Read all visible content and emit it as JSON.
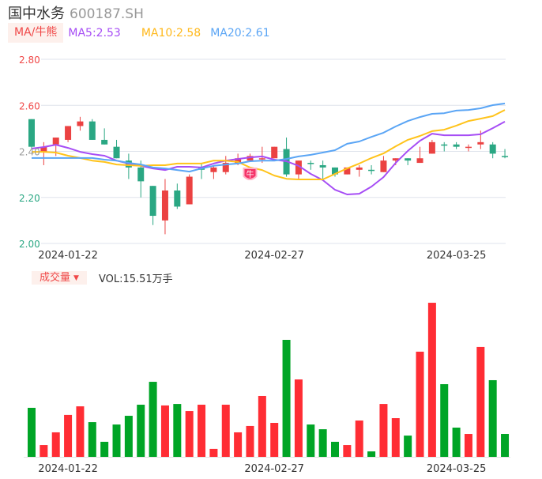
{
  "header": {
    "name": "国中水务",
    "code": "600187.SH"
  },
  "ma_legend": {
    "tag": "MA/牛熊",
    "ma5": "MA5:2.53",
    "ma10": "MA10:2.58",
    "ma20": "MA20:2.61"
  },
  "volume_legend": {
    "tag": "成交量",
    "tag_arrow": "▼",
    "value": "VOL:15.51万手"
  },
  "colors": {
    "up": "#eb4242",
    "down": "#2aa783",
    "vol_up": "#ff2d34",
    "vol_down": "#00a526",
    "ma5": "#a64df5",
    "ma10": "#ffc31a",
    "ma20": "#5aa5f5",
    "grid": "#dfe3ec"
  },
  "marker": {
    "label": "牛",
    "icon": "bull-shield-icon",
    "index": 18
  },
  "chart_data": [
    {
      "type": "candlestick",
      "ylim": [
        2.0,
        2.8
      ],
      "y_ticks": [
        {
          "label": "2.80",
          "value": 2.8,
          "color": "#f04848"
        },
        {
          "label": "2.60",
          "value": 2.6,
          "color": "#f04848"
        },
        {
          "label": "2.40",
          "value": 2.4,
          "color": "#999999"
        },
        {
          "label": "2.20",
          "value": 2.2,
          "color": "#2aa783"
        },
        {
          "label": "2.00",
          "value": 2.0,
          "color": "#2aa783"
        }
      ],
      "x_ticks": [
        {
          "label": "2024-01-22",
          "index": 3
        },
        {
          "label": "2024-02-27",
          "index": 20
        },
        {
          "label": "2024-03-25",
          "index": 35
        }
      ],
      "candles": [
        {
          "o": 2.54,
          "h": 2.54,
          "l": 2.41,
          "c": 2.42,
          "dir": "down"
        },
        {
          "o": 2.4,
          "h": 2.44,
          "l": 2.34,
          "c": 2.42,
          "dir": "up"
        },
        {
          "o": 2.43,
          "h": 2.46,
          "l": 2.38,
          "c": 2.46,
          "dir": "up"
        },
        {
          "o": 2.45,
          "h": 2.51,
          "l": 2.44,
          "c": 2.51,
          "dir": "up"
        },
        {
          "o": 2.51,
          "h": 2.55,
          "l": 2.49,
          "c": 2.53,
          "dir": "up"
        },
        {
          "o": 2.53,
          "h": 2.54,
          "l": 2.45,
          "c": 2.45,
          "dir": "down"
        },
        {
          "o": 2.45,
          "h": 2.5,
          "l": 2.43,
          "c": 2.43,
          "dir": "down"
        },
        {
          "o": 2.42,
          "h": 2.45,
          "l": 2.37,
          "c": 2.37,
          "dir": "down"
        },
        {
          "o": 2.36,
          "h": 2.39,
          "l": 2.28,
          "c": 2.33,
          "dir": "down"
        },
        {
          "o": 2.33,
          "h": 2.36,
          "l": 2.2,
          "c": 2.27,
          "dir": "down"
        },
        {
          "o": 2.25,
          "h": 2.25,
          "l": 2.08,
          "c": 2.12,
          "dir": "down"
        },
        {
          "o": 2.1,
          "h": 2.28,
          "l": 2.04,
          "c": 2.23,
          "dir": "up"
        },
        {
          "o": 2.23,
          "h": 2.26,
          "l": 2.15,
          "c": 2.16,
          "dir": "down"
        },
        {
          "o": 2.17,
          "h": 2.3,
          "l": 2.17,
          "c": 2.29,
          "dir": "up"
        },
        {
          "o": 2.33,
          "h": 2.35,
          "l": 2.28,
          "c": 2.32,
          "dir": "down"
        },
        {
          "o": 2.31,
          "h": 2.34,
          "l": 2.28,
          "c": 2.33,
          "dir": "up"
        },
        {
          "o": 2.31,
          "h": 2.38,
          "l": 2.3,
          "c": 2.35,
          "dir": "up"
        },
        {
          "o": 2.35,
          "h": 2.39,
          "l": 2.34,
          "c": 2.37,
          "dir": "up"
        },
        {
          "o": 2.36,
          "h": 2.39,
          "l": 2.36,
          "c": 2.38,
          "dir": "up"
        },
        {
          "o": 2.37,
          "h": 2.42,
          "l": 2.35,
          "c": 2.37,
          "dir": "up"
        },
        {
          "o": 2.37,
          "h": 2.42,
          "l": 2.37,
          "c": 2.42,
          "dir": "up"
        },
        {
          "o": 2.41,
          "h": 2.46,
          "l": 2.29,
          "c": 2.3,
          "dir": "down"
        },
        {
          "o": 2.3,
          "h": 2.36,
          "l": 2.28,
          "c": 2.36,
          "dir": "up"
        },
        {
          "o": 2.35,
          "h": 2.36,
          "l": 2.32,
          "c": 2.35,
          "dir": "down"
        },
        {
          "o": 2.34,
          "h": 2.36,
          "l": 2.28,
          "c": 2.33,
          "dir": "down"
        },
        {
          "o": 2.33,
          "h": 2.33,
          "l": 2.29,
          "c": 2.3,
          "dir": "down"
        },
        {
          "o": 2.3,
          "h": 2.33,
          "l": 2.3,
          "c": 2.33,
          "dir": "up"
        },
        {
          "o": 2.32,
          "h": 2.34,
          "l": 2.29,
          "c": 2.33,
          "dir": "up"
        },
        {
          "o": 2.32,
          "h": 2.34,
          "l": 2.3,
          "c": 2.32,
          "dir": "down"
        },
        {
          "o": 2.31,
          "h": 2.38,
          "l": 2.31,
          "c": 2.36,
          "dir": "up"
        },
        {
          "o": 2.36,
          "h": 2.37,
          "l": 2.34,
          "c": 2.37,
          "dir": "up"
        },
        {
          "o": 2.37,
          "h": 2.37,
          "l": 2.34,
          "c": 2.36,
          "dir": "down"
        },
        {
          "o": 2.35,
          "h": 2.42,
          "l": 2.35,
          "c": 2.37,
          "dir": "up"
        },
        {
          "o": 2.39,
          "h": 2.45,
          "l": 2.39,
          "c": 2.44,
          "dir": "up"
        },
        {
          "o": 2.43,
          "h": 2.44,
          "l": 2.4,
          "c": 2.43,
          "dir": "down"
        },
        {
          "o": 2.43,
          "h": 2.44,
          "l": 2.41,
          "c": 2.42,
          "dir": "down"
        },
        {
          "o": 2.42,
          "h": 2.43,
          "l": 2.4,
          "c": 2.42,
          "dir": "up"
        },
        {
          "o": 2.43,
          "h": 2.49,
          "l": 2.41,
          "c": 2.44,
          "dir": "up"
        },
        {
          "o": 2.43,
          "h": 2.44,
          "l": 2.37,
          "c": 2.39,
          "dir": "down"
        },
        {
          "o": 2.38,
          "h": 2.41,
          "l": 2.37,
          "c": 2.38,
          "dir": "down"
        }
      ],
      "series": [
        {
          "name": "MA5",
          "values": [
            2.412,
            2.419,
            2.429,
            2.415,
            2.398,
            2.388,
            2.381,
            2.36,
            2.347,
            2.337,
            2.326,
            2.319,
            2.333,
            2.333,
            2.33,
            2.347,
            2.36,
            2.367,
            2.374,
            2.378,
            2.364,
            2.357,
            2.337,
            2.302,
            2.275,
            2.233,
            2.213,
            2.216,
            2.247,
            2.288,
            2.35,
            2.402,
            2.446,
            2.477,
            2.47,
            2.47,
            2.47,
            2.474,
            2.501,
            2.529
          ]
        },
        {
          "name": "MA10",
          "values": [
            2.398,
            2.398,
            2.395,
            2.381,
            2.371,
            2.36,
            2.354,
            2.343,
            2.34,
            2.337,
            2.34,
            2.34,
            2.347,
            2.347,
            2.347,
            2.36,
            2.36,
            2.354,
            2.33,
            2.319,
            2.295,
            2.281,
            2.278,
            2.278,
            2.278,
            2.302,
            2.326,
            2.347,
            2.371,
            2.391,
            2.422,
            2.45,
            2.467,
            2.488,
            2.494,
            2.512,
            2.532,
            2.542,
            2.553,
            2.58
          ]
        },
        {
          "name": "MA20",
          "values": [
            2.371,
            2.371,
            2.371,
            2.371,
            2.371,
            2.371,
            2.364,
            2.36,
            2.35,
            2.343,
            2.33,
            2.326,
            2.319,
            2.312,
            2.326,
            2.337,
            2.343,
            2.347,
            2.357,
            2.36,
            2.36,
            2.367,
            2.378,
            2.385,
            2.395,
            2.405,
            2.433,
            2.443,
            2.463,
            2.481,
            2.508,
            2.532,
            2.549,
            2.563,
            2.566,
            2.577,
            2.58,
            2.587,
            2.601,
            2.608
          ]
        }
      ]
    },
    {
      "type": "bar",
      "unit": "万手",
      "x_ticks": [
        {
          "label": "2024-01-22",
          "index": 3
        },
        {
          "label": "2024-02-27",
          "index": 20
        },
        {
          "label": "2024-03-25",
          "index": 35
        }
      ],
      "values": [
        33.2,
        8.0,
        16.6,
        28.4,
        34.2,
        23.5,
        10.2,
        21.9,
        27.8,
        35.3,
        50.8,
        34.8,
        35.8,
        31.0,
        35.3,
        5.4,
        35.3,
        16.6,
        20.9,
        41.2,
        23.0,
        79.2,
        52.4,
        21.9,
        18.7,
        10.2,
        8.0,
        24.6,
        3.7,
        35.8,
        26.2,
        14.4,
        71.2,
        104.3,
        49.2,
        19.8,
        15.5,
        74.4,
        51.9,
        15.51
      ],
      "dirs": [
        "down",
        "up",
        "up",
        "up",
        "up",
        "down",
        "down",
        "down",
        "down",
        "down",
        "down",
        "up",
        "down",
        "up",
        "up",
        "up",
        "up",
        "up",
        "up",
        "up",
        "up",
        "down",
        "up",
        "down",
        "down",
        "down",
        "up",
        "up",
        "down",
        "up",
        "up",
        "down",
        "up",
        "up",
        "down",
        "down",
        "up",
        "up",
        "down",
        "down"
      ]
    }
  ]
}
